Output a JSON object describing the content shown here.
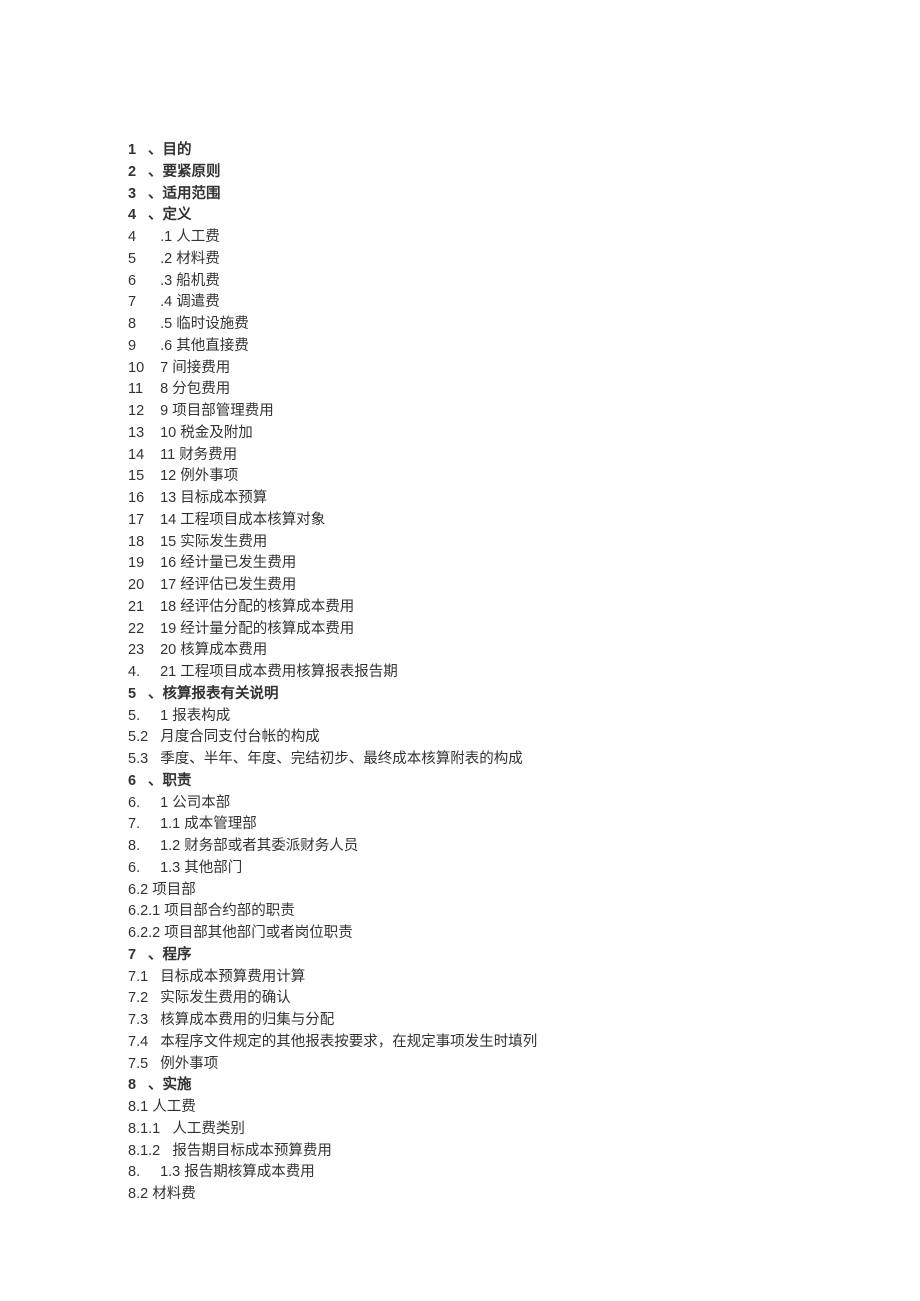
{
  "toc": [
    {
      "bold": true,
      "num": "1",
      "text": "目的"
    },
    {
      "bold": true,
      "num": "2",
      "text": "要紧原则"
    },
    {
      "bold": true,
      "num": "3",
      "text": "适用范围"
    },
    {
      "bold": true,
      "num": "4",
      "text": "定义"
    },
    {
      "num": "4",
      "sub": ".1",
      "text": "人工费"
    },
    {
      "num": "5",
      "sub": ".2",
      "text": "材料费"
    },
    {
      "num": "6",
      "sub": ".3",
      "text": "船机费"
    },
    {
      "num": "7",
      "sub": ".4",
      "text": "调遣费"
    },
    {
      "num": "8",
      "sub": ".5",
      "text": "临时设施费"
    },
    {
      "num": "9",
      "sub": ".6",
      "text": "其他直接费"
    },
    {
      "num": "10",
      "sub": "7",
      "text": "间接费用"
    },
    {
      "num": "11",
      "sub": "8",
      "text": "分包费用"
    },
    {
      "num": "12",
      "sub": "9",
      "text": "项目部管理费用"
    },
    {
      "num": "13",
      "sub": "10",
      "text": "税金及附加"
    },
    {
      "num": "14",
      "sub": "11",
      "text": "财务费用"
    },
    {
      "num": "15",
      "sub": "12",
      "text": "例外事项"
    },
    {
      "num": "16",
      "sub": "13",
      "text": "目标成本预算"
    },
    {
      "num": "17",
      "sub": "14",
      "text": "工程项目成本核算对象"
    },
    {
      "num": "18",
      "sub": "15",
      "text": "实际发生费用"
    },
    {
      "num": "19",
      "sub": "16",
      "text": "经计量已发生费用"
    },
    {
      "num": "20",
      "sub": "17",
      "text": "经评估已发生费用"
    },
    {
      "num": "21",
      "sub": "18",
      "text": "经评估分配的核算成本费用"
    },
    {
      "num": "22",
      "sub": "19",
      "text": "经计量分配的核算成本费用"
    },
    {
      "num": "23",
      "sub": "20",
      "text": "核算成本费用"
    },
    {
      "num": "4.",
      "sub": "21",
      "text": "工程项目成本费用核算报表报告期"
    },
    {
      "bold": true,
      "num": "5",
      "text": "核算报表有关说明"
    },
    {
      "num": "5.",
      "sub": "1",
      "text": "报表构成"
    },
    {
      "num": "5.2",
      "sub": "",
      "text": "月度合同支付台帐的构成"
    },
    {
      "num": "5.3",
      "sub": "",
      "text": "季度、半年、年度、完结初步、最终成本核算附表的构成"
    },
    {
      "bold": true,
      "num": "6",
      "text": "职责"
    },
    {
      "num": "6.",
      "sub": "1",
      "text": "公司本部"
    },
    {
      "num": "7.",
      "sub": "1.1",
      "text": "成本管理部"
    },
    {
      "num": "8.",
      "sub": "1.2",
      "text": "财务部或者其委派财务人员"
    },
    {
      "num": "6.",
      "sub": "1.3",
      "text": "其他部门"
    },
    {
      "num": "6.2",
      "text": "项目部"
    },
    {
      "num": "6.2.1",
      "text": "项目部合约部的职责"
    },
    {
      "num": "6.2.2",
      "text": "项目部其他部门或者岗位职责"
    },
    {
      "bold": true,
      "num": "7",
      "text": "程序"
    },
    {
      "num": "7.1",
      "sub": "",
      "text": "目标成本预算费用计算"
    },
    {
      "num": "7.2",
      "sub": "",
      "text": "实际发生费用的确认"
    },
    {
      "num": "7.3",
      "sub": "",
      "text": "核算成本费用的归集与分配"
    },
    {
      "num": "7.4",
      "sub": "",
      "text": "本程序文件规定的其他报表按要求，在规定事项发生时填列"
    },
    {
      "num": "7.5",
      "sub": "",
      "text": "例外事项"
    },
    {
      "bold": true,
      "num": "8",
      "text": "实施"
    },
    {
      "num": "8.1",
      "text": "人工费"
    },
    {
      "num": "8.1.1",
      "sub": "",
      "text": "人工费类别"
    },
    {
      "num": "8.1.2",
      "sub": "",
      "text": "报告期目标成本预算费用"
    },
    {
      "num": "8.",
      "sub": "1.3",
      "text": "报告期核算成本费用"
    },
    {
      "num": "8.2",
      "text": "材料费"
    }
  ]
}
